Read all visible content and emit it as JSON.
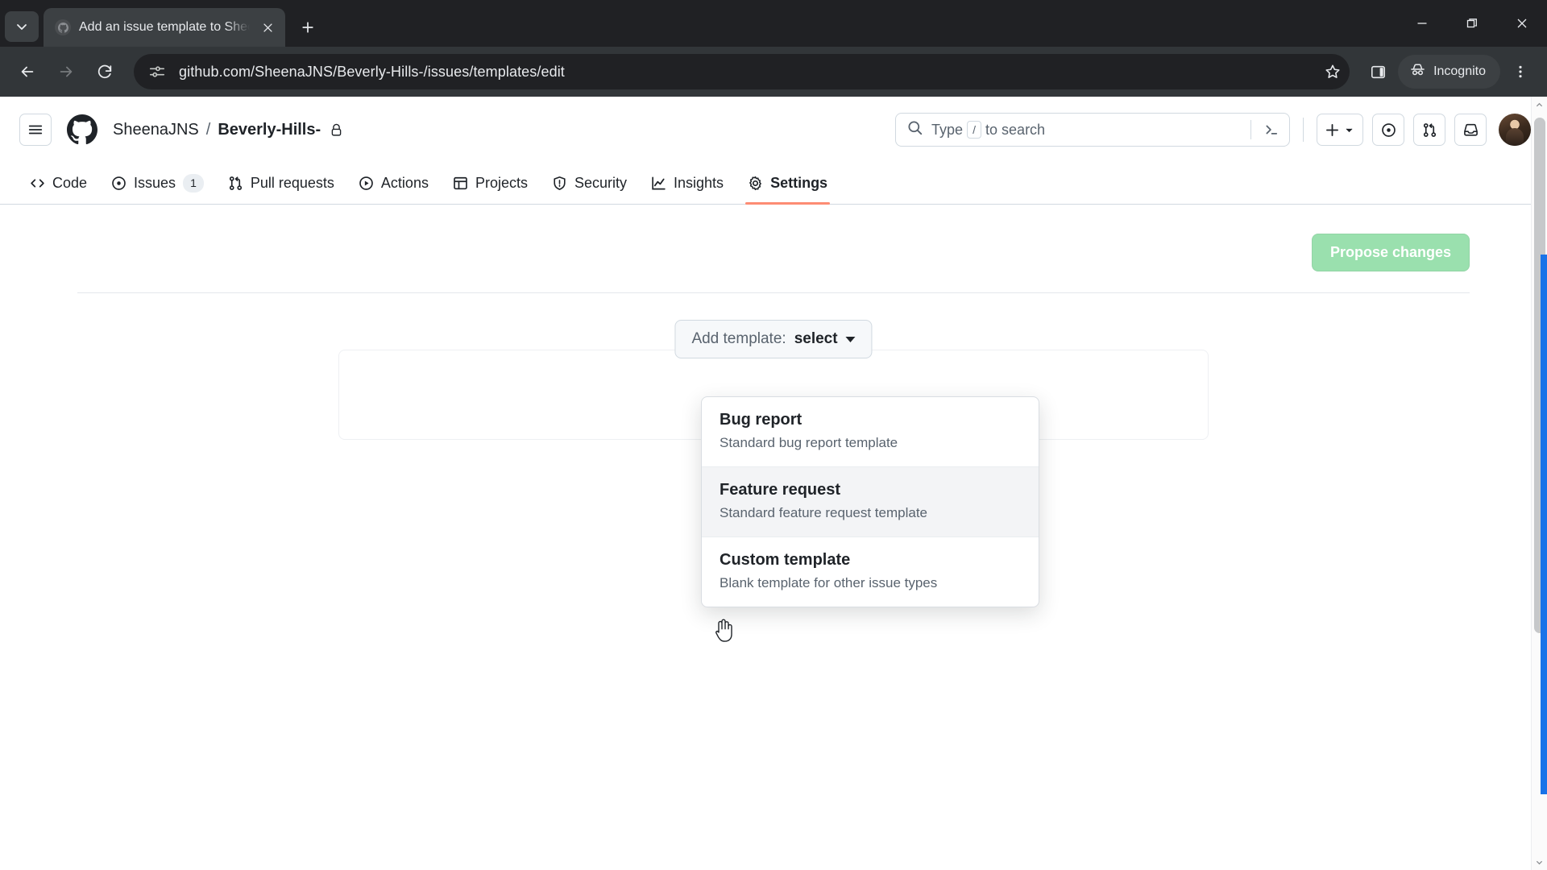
{
  "browser": {
    "tab": {
      "title": "Add an issue template to Sheen",
      "favicon_icon": "github-favicon",
      "close_icon": "close-icon"
    },
    "tab_list_icon": "chevron-down-icon",
    "new_tab_icon": "plus-icon",
    "window_controls": {
      "minimize_icon": "minimize-icon",
      "maximize_icon": "restore-icon",
      "close_icon": "close-icon"
    },
    "toolbar": {
      "back_icon": "arrow-left-icon",
      "forward_icon": "arrow-right-icon",
      "reload_icon": "reload-icon",
      "site_info_icon": "site-settings-icon",
      "url": "github.com/SheenaJNS/Beverly-Hills-/issues/templates/edit",
      "bookmark_icon": "star-icon",
      "side_panel_icon": "side-panel-icon",
      "incognito_label": "Incognito",
      "incognito_icon": "incognito-icon",
      "menu_icon": "three-dots-vertical-icon"
    }
  },
  "github": {
    "header": {
      "hamburger_icon": "hamburger-icon",
      "logo_icon": "github-logo-icon",
      "owner": "SheenaJNS",
      "separator": "/",
      "repo": "Beverly-Hills-",
      "visibility_icon": "lock-icon",
      "search": {
        "icon": "search-icon",
        "placeholder_pre": "Type",
        "placeholder_key": "/",
        "placeholder_post": "to search",
        "command_palette_icon": "terminal-icon"
      },
      "actions": {
        "create_new_label": "",
        "create_new_icon": "plus-icon",
        "create_new_caret_icon": "chevron-down-icon",
        "issues_icon": "issue-opened-icon",
        "pull_requests_icon": "git-pull-request-icon",
        "notifications_icon": "inbox-icon",
        "avatar_icon": "avatar"
      }
    },
    "nav": [
      {
        "label": "Code",
        "icon": "code-icon",
        "count": null,
        "active": false
      },
      {
        "label": "Issues",
        "icon": "issue-opened-icon",
        "count": "1",
        "active": false
      },
      {
        "label": "Pull requests",
        "icon": "git-pull-request-icon",
        "count": null,
        "active": false
      },
      {
        "label": "Actions",
        "icon": "play-icon",
        "count": null,
        "active": false
      },
      {
        "label": "Projects",
        "icon": "table-icon",
        "count": null,
        "active": false
      },
      {
        "label": "Security",
        "icon": "shield-icon",
        "count": null,
        "active": false
      },
      {
        "label": "Insights",
        "icon": "graph-icon",
        "count": null,
        "active": false
      },
      {
        "label": "Settings",
        "icon": "gear-icon",
        "count": null,
        "active": true
      }
    ],
    "main": {
      "propose_changes_label": "Propose changes",
      "add_template_prefix": "Add template:",
      "add_template_value": "select",
      "template_menu": [
        {
          "title": "Bug report",
          "desc": "Standard bug report template",
          "hovered": false
        },
        {
          "title": "Feature request",
          "desc": "Standard feature request template",
          "hovered": true
        },
        {
          "title": "Custom template",
          "desc": "Blank template for other issue types",
          "hovered": false
        }
      ]
    }
  },
  "colors": {
    "accent_active_tab": "#fd8c73",
    "propose_button": "#9ae0ae",
    "chrome_dark": "#323639",
    "focus_blue": "#1a73e8"
  }
}
